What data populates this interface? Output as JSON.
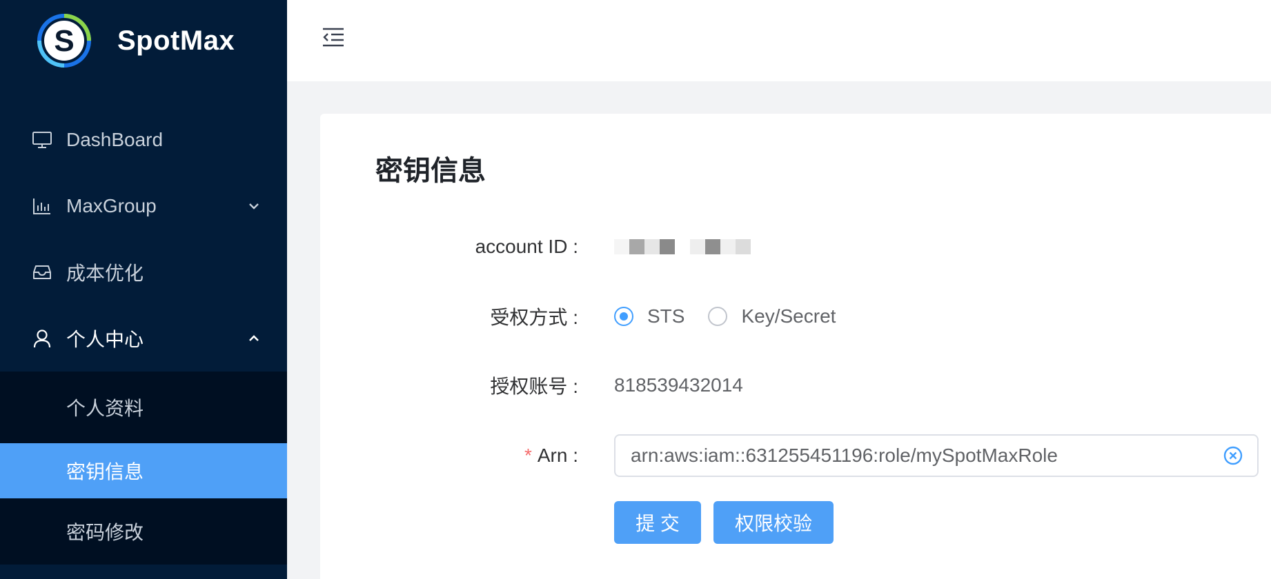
{
  "app": {
    "name": "SpotMax"
  },
  "sidebar": {
    "items": [
      {
        "label": "DashBoard",
        "icon": "monitor-icon"
      },
      {
        "label": "MaxGroup",
        "icon": "bar-chart-icon",
        "arrow": "chevron-down-icon"
      },
      {
        "label": "成本优化",
        "icon": "inbox-icon"
      },
      {
        "label": "个人中心",
        "icon": "user-icon",
        "arrow": "chevron-up-icon"
      }
    ],
    "submenu": [
      {
        "label": "个人资料"
      },
      {
        "label": "密钥信息",
        "active": true
      },
      {
        "label": "密码修改"
      }
    ]
  },
  "header": {
    "toggle_icon": "menu-fold-icon"
  },
  "card": {
    "title": "密钥信息",
    "form": {
      "account_label": "account ID",
      "auth_method_label": "受权方式",
      "auth_options": [
        "STS",
        "Key/Secret"
      ],
      "auth_selected": "STS",
      "auth_account_label": "授权账号",
      "auth_account_value": "818539432014",
      "arn_label": "Arn",
      "arn_value": "arn:aws:iam::631255451196:role/mySpotMaxRole",
      "submit_label": "提 交",
      "verify_label": "权限校验"
    }
  },
  "colors": {
    "sidebar_bg": "#021c39",
    "submenu_bg": "#000f22",
    "accent": "#4fa0f7",
    "required": "#f56c6c"
  }
}
